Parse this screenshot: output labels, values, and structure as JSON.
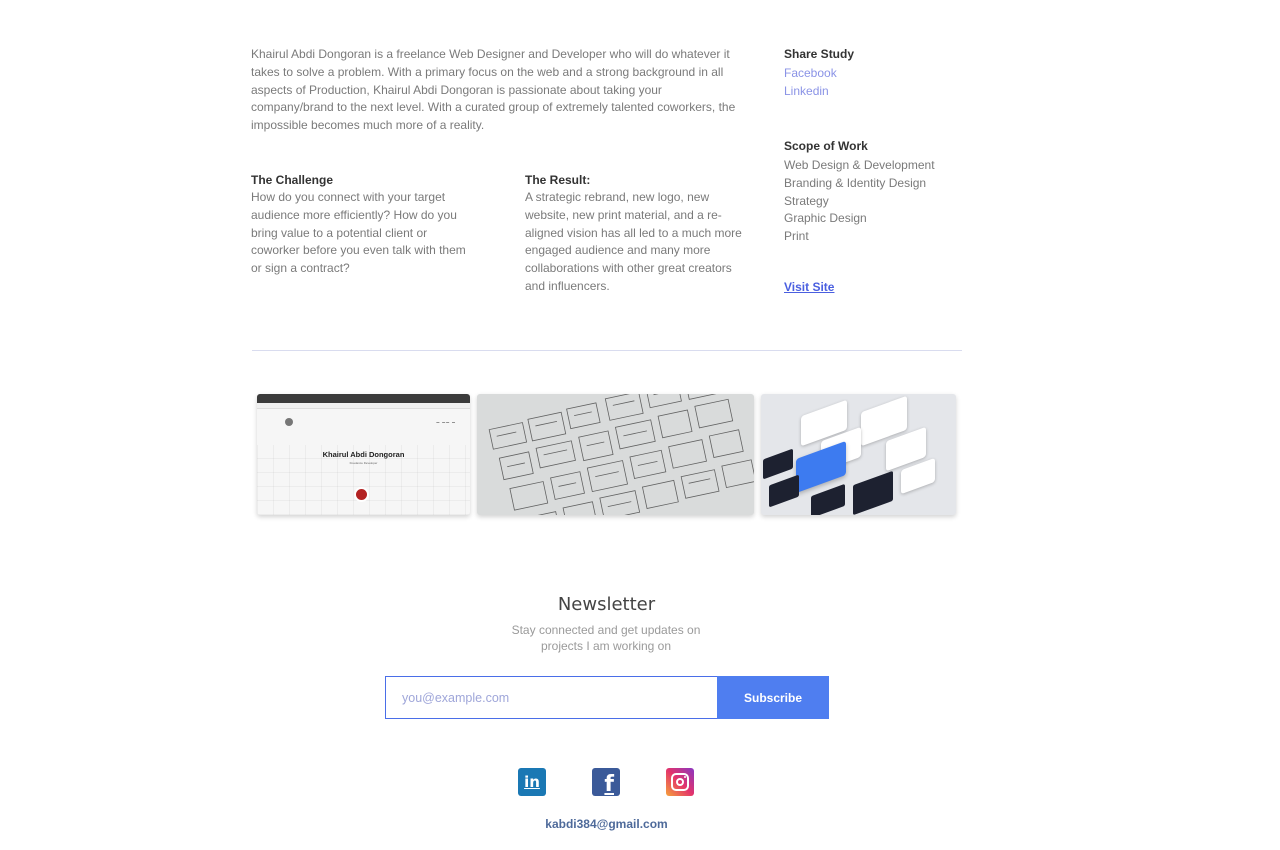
{
  "intro": "Khairul Abdi Dongoran is a freelance Web Designer and Developer who will do whatever it takes to solve a problem. With a primary focus on the web and a strong background in all aspects of Production, Khairul Abdi Dongoran is passionate about taking your company/brand to the next level. With a curated group of extremely talented coworkers, the impossible becomes much more of a reality.",
  "challenge": {
    "title": "The Challenge",
    "text": "How do you connect with your target audience more efficiently? How do you bring value to a potential client or coworker before you even talk with them or sign a contract?"
  },
  "result": {
    "title": "The Result:",
    "text": "A strategic rebrand, new logo, new website, new print material, and a re-aligned vision has all led to a much more engaged audience and many more collaborations with other great creators and influencers."
  },
  "share": {
    "title": "Share Study",
    "links": [
      "Facebook",
      "Linkedin"
    ]
  },
  "scope": {
    "title": "Scope of Work",
    "items": [
      "Web Design & Development",
      "Branding & Identity Design",
      "Strategy",
      "Graphic Design",
      "Print"
    ]
  },
  "visit_label": "Visit Site",
  "gallery": {
    "thumb1": {
      "name": "Khairul Abdi Dongoran",
      "subtitle": "Freelance Developer"
    }
  },
  "newsletter": {
    "title": "Newsletter",
    "subtitle": "Stay connected and get updates on projects I am working on",
    "placeholder": "you@example.com",
    "button": "Subscribe"
  },
  "social": {
    "icons": [
      "linkedin-icon",
      "facebook-icon",
      "instagram-icon"
    ],
    "linkedin_glyph": "in",
    "facebook_glyph": "f"
  },
  "email": "kabdi384@gmail.com",
  "colors": {
    "accent": "#4f7ef0",
    "link": "#8a93e6",
    "visit": "#4a5fe0",
    "linkedin": "#1a78b4",
    "facebook": "#3b5a99"
  }
}
